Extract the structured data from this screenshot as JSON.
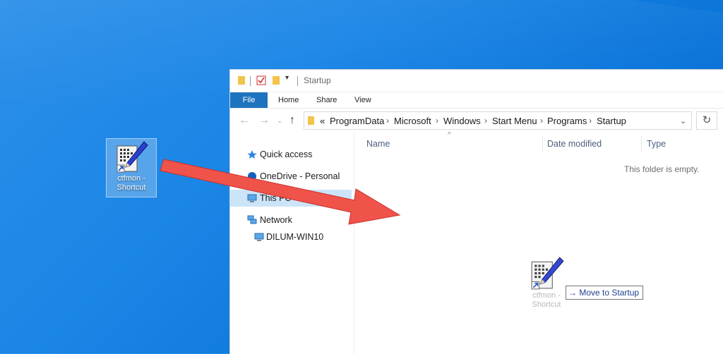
{
  "desktop": {
    "shortcut": {
      "label_line1": "ctfmon -",
      "label_line2": "Shortcut"
    }
  },
  "window": {
    "title": "Startup",
    "ribbon_tabs": [
      "File",
      "Home",
      "Share",
      "View"
    ],
    "address": {
      "overflow": "«",
      "crumbs": [
        "ProgramData",
        "Microsoft",
        "Windows",
        "Start Menu",
        "Programs",
        "Startup"
      ]
    },
    "nav": {
      "items": [
        {
          "label": "Quick access",
          "icon": "star-icon",
          "selected": false
        },
        {
          "label": "OneDrive - Personal",
          "icon": "cloud-icon",
          "selected": false
        },
        {
          "label": "This PC",
          "icon": "computer-icon",
          "selected": true
        },
        {
          "label": "Network",
          "icon": "network-icon",
          "selected": false
        },
        {
          "label": "DILUM-WIN10",
          "icon": "computer-icon",
          "selected": false
        }
      ]
    },
    "columns": [
      "Name",
      "Date modified",
      "Type"
    ],
    "empty_text": "This folder is empty.",
    "drag": {
      "ghost_line1": "ctfmon -",
      "ghost_line2": "Shortcut",
      "tooltip": "Move to Startup"
    }
  },
  "colors": {
    "desktop": "#1b86e6",
    "file_tab": "#1e73be",
    "selected_nav": "#cce4f7",
    "arrow": "#f0534a"
  }
}
